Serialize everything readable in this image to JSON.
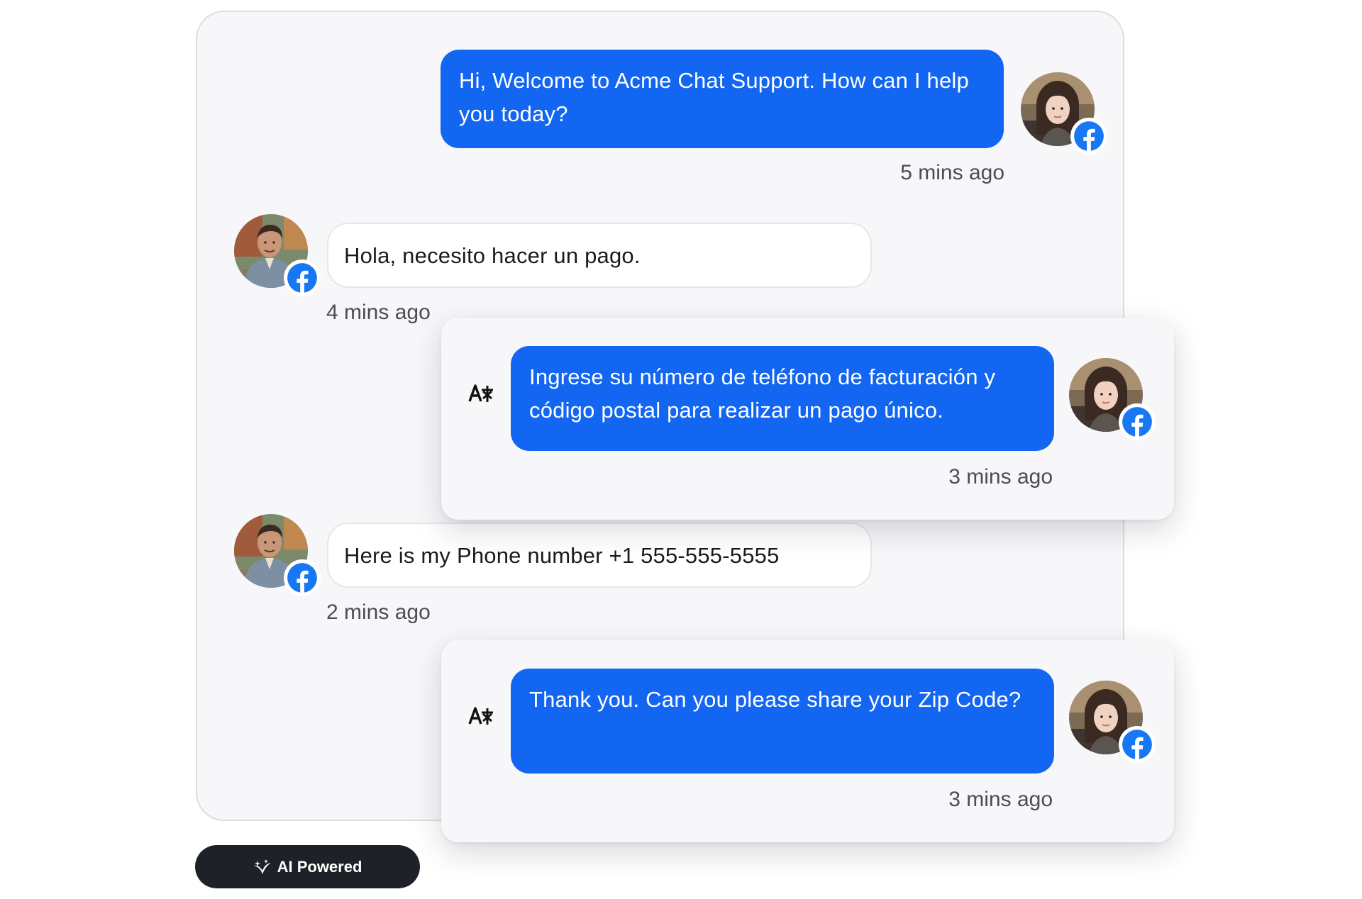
{
  "messages": [
    {
      "sender": "agent",
      "text": "Hi, Welcome to Acme Chat Support. How can I help you today?",
      "time": "5 mins ago",
      "channel": "facebook"
    },
    {
      "sender": "customer",
      "text": "Hola, necesito hacer un pago.",
      "time": "4 mins ago",
      "channel": "facebook"
    },
    {
      "sender": "agent",
      "translated": true,
      "text": "Ingrese su número de teléfono de facturación y código postal para realizar un pago único.",
      "time": "3 mins ago",
      "channel": "facebook"
    },
    {
      "sender": "customer",
      "text": "Here is my Phone number +1 555-555-5555",
      "time": "2 mins ago",
      "channel": "facebook"
    },
    {
      "sender": "agent",
      "translated": true,
      "text": "Thank you. Can you please share your Zip Code?",
      "time": "3 mins ago",
      "channel": "facebook"
    }
  ],
  "badge": {
    "label": "AI Powered",
    "icon": "sparkle-leaf-icon"
  },
  "icons": {
    "translate": "translate-icon",
    "channel": "facebook-icon"
  },
  "colors": {
    "agent_bubble": "#1266f1",
    "customer_bubble": "#ffffff",
    "panel": "#f7f7f9",
    "facebook": "#1877f2",
    "badge_bg": "#1f2128"
  }
}
